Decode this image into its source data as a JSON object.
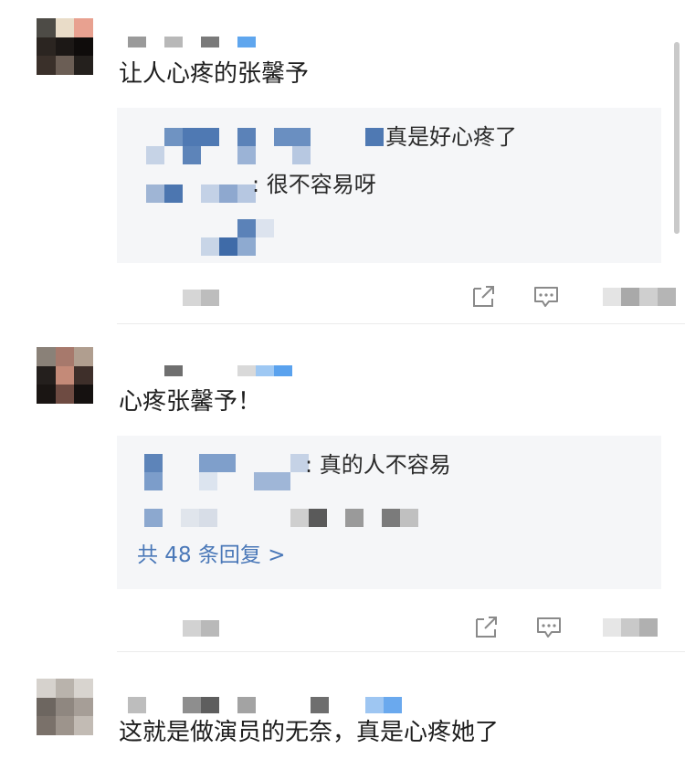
{
  "comments": [
    {
      "text": "让人心疼的张馨予",
      "replies": [
        "真是好心疼了",
        ": 很不容易呀"
      ],
      "more_replies": ""
    },
    {
      "text": "心疼张馨予！",
      "replies": [
        ": 真的人不容易"
      ],
      "more_replies": "共 48 条回复 >"
    },
    {
      "text": "这就是做演员的无奈，真是心疼她了",
      "replies": [],
      "more_replies": ""
    }
  ],
  "icons": [
    "share-icon",
    "comment-icon",
    "like-icon"
  ],
  "colors": {
    "link": "#4a78b8",
    "reply_bg": "#f5f6f8",
    "text": "#1d1d1d"
  }
}
